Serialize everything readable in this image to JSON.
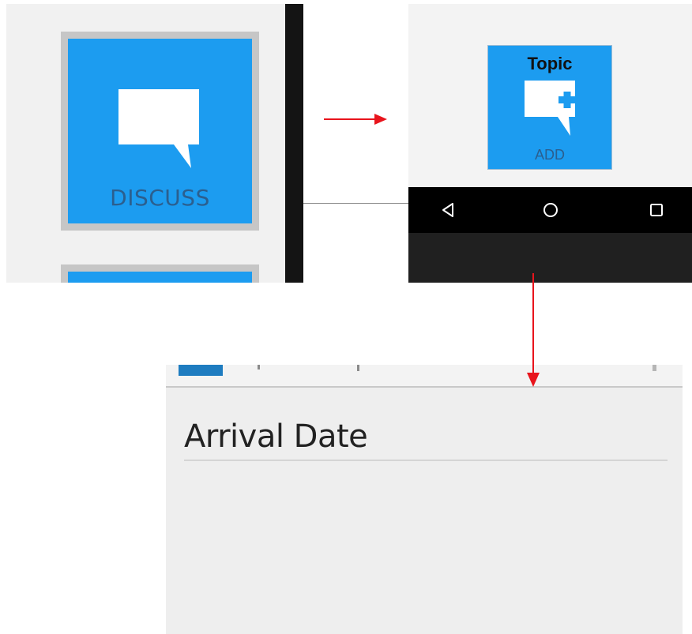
{
  "discuss_panel": {
    "tile_label": "DISCUSS"
  },
  "topic_panel": {
    "tile_title": "Topic",
    "tile_label": "ADD",
    "nav": {
      "back": "back-icon",
      "home": "home-icon",
      "recents": "recents-icon"
    }
  },
  "form_panel": {
    "field_label": "Arrival Date"
  },
  "colors": {
    "tile_blue": "#1c9cf0",
    "tile_label_text": "#2b5f8f",
    "arrow_red": "#e8141c",
    "nav_bar": "#000000"
  }
}
